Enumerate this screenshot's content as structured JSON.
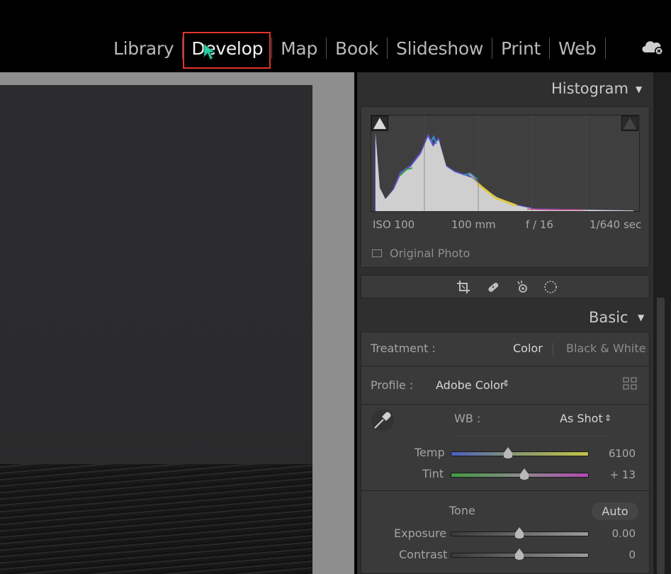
{
  "modules": {
    "items": [
      "Library",
      "Develop",
      "Map",
      "Book",
      "Slideshow",
      "Print",
      "Web"
    ],
    "active": "Develop"
  },
  "histogram": {
    "title": "Histogram",
    "iso": "ISO 100",
    "focal": "100 mm",
    "aperture": "f / 16",
    "shutter": "1/640 sec",
    "original_photo": "Original Photo"
  },
  "basic": {
    "title": "Basic",
    "treatment_label": "Treatment :",
    "treatment_color": "Color",
    "treatment_bw": "Black & White",
    "profile_label": "Profile :",
    "profile_value": "Adobe Color",
    "wb_label": "WB :",
    "wb_value": "As Shot",
    "temp_label": "Temp",
    "temp_value": "6100",
    "temp_position": 0.42,
    "tint_label": "Tint",
    "tint_value": "+ 13",
    "tint_position": 0.54,
    "tone_label": "Tone",
    "auto_label": "Auto",
    "exposure_label": "Exposure",
    "exposure_value": "0.00",
    "exposure_position": 0.5,
    "contrast_label": "Contrast",
    "contrast_value": "0",
    "contrast_position": 0.5
  },
  "colors": {
    "highlight": "#e2352b",
    "cursor": "#2bd1a6"
  }
}
